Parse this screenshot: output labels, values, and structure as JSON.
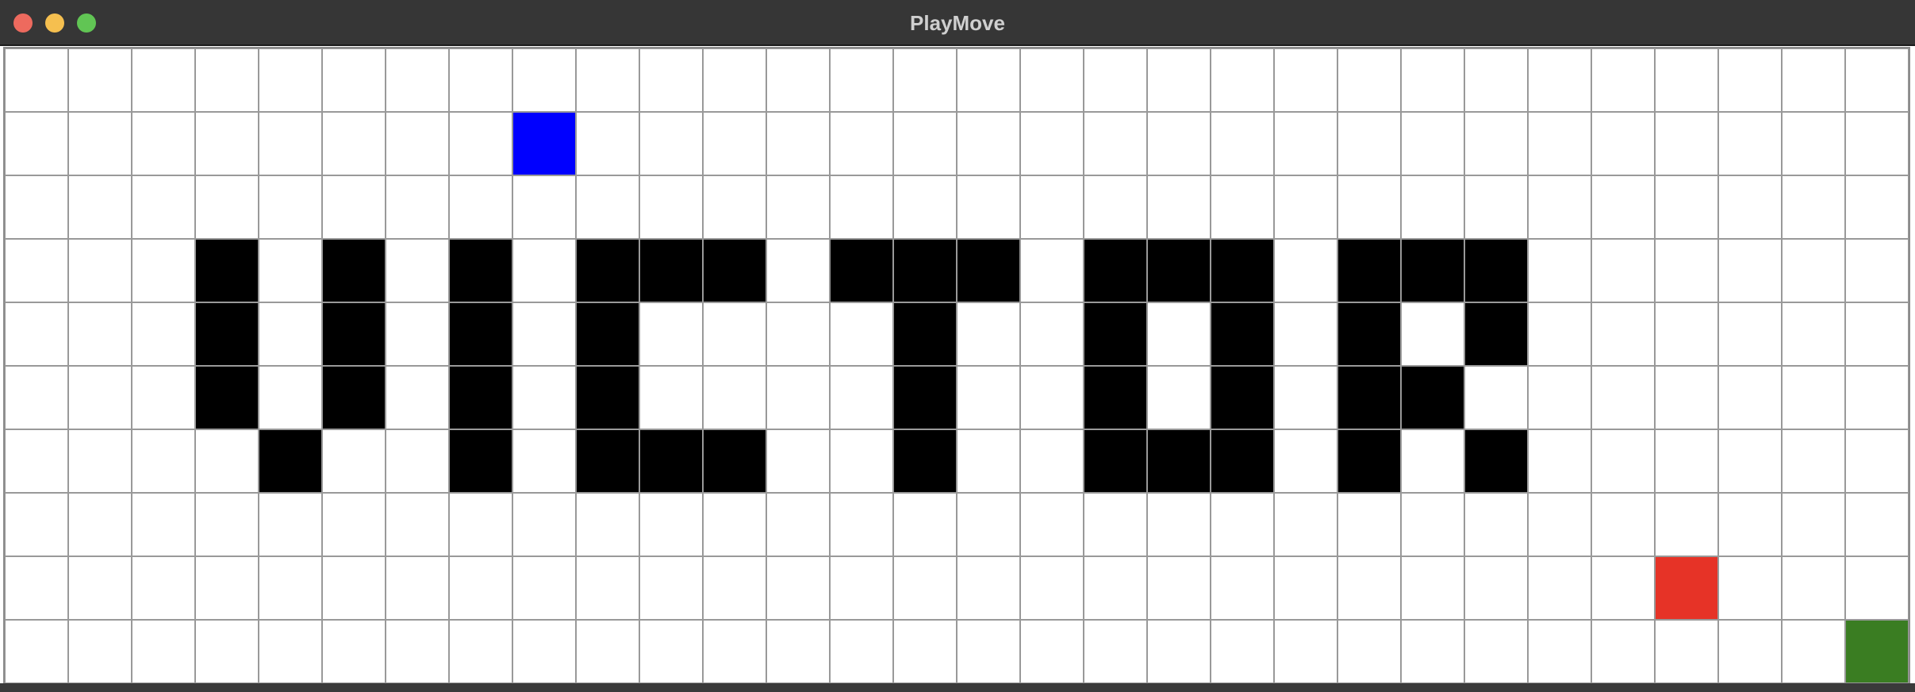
{
  "window": {
    "title": "PlayMove"
  },
  "colors": {
    "empty": "#ffffff",
    "wall": "#000000",
    "player": "#0000ff",
    "enemy": "#e63327",
    "goal": "#3a7d22",
    "gridline": "#999999"
  },
  "board": {
    "columns": 30,
    "rows": 10,
    "walls": [
      [
        3,
        3
      ],
      [
        5,
        3
      ],
      [
        7,
        3
      ],
      [
        9,
        3
      ],
      [
        10,
        3
      ],
      [
        11,
        3
      ],
      [
        13,
        3
      ],
      [
        14,
        3
      ],
      [
        15,
        3
      ],
      [
        17,
        3
      ],
      [
        18,
        3
      ],
      [
        19,
        3
      ],
      [
        21,
        3
      ],
      [
        22,
        3
      ],
      [
        23,
        3
      ],
      [
        3,
        4
      ],
      [
        5,
        4
      ],
      [
        7,
        4
      ],
      [
        9,
        4
      ],
      [
        14,
        4
      ],
      [
        17,
        4
      ],
      [
        19,
        4
      ],
      [
        21,
        4
      ],
      [
        23,
        4
      ],
      [
        3,
        5
      ],
      [
        5,
        5
      ],
      [
        7,
        5
      ],
      [
        9,
        5
      ],
      [
        14,
        5
      ],
      [
        17,
        5
      ],
      [
        19,
        5
      ],
      [
        21,
        5
      ],
      [
        22,
        5
      ],
      [
        4,
        6
      ],
      [
        7,
        6
      ],
      [
        9,
        6
      ],
      [
        10,
        6
      ],
      [
        11,
        6
      ],
      [
        14,
        6
      ],
      [
        17,
        6
      ],
      [
        18,
        6
      ],
      [
        19,
        6
      ],
      [
        21,
        6
      ],
      [
        23,
        6
      ]
    ],
    "pieces": [
      {
        "name": "player-piece",
        "type": "player",
        "col": 8,
        "row": 1
      },
      {
        "name": "enemy-piece",
        "type": "enemy",
        "col": 26,
        "row": 8
      },
      {
        "name": "goal-tile",
        "type": "goal",
        "col": 29,
        "row": 9
      }
    ]
  }
}
